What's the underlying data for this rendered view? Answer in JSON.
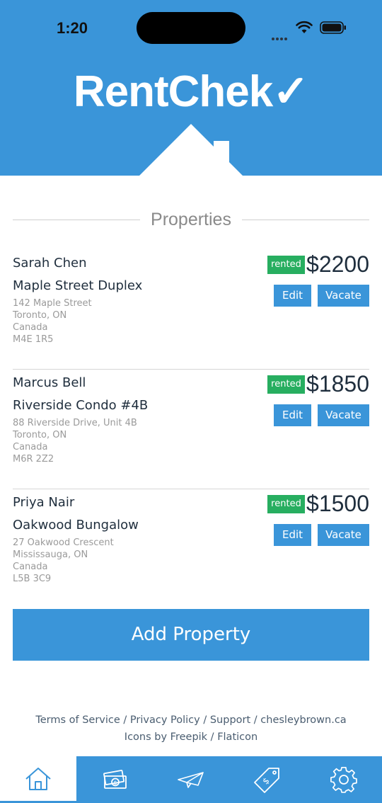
{
  "status_bar": {
    "time": "1:20"
  },
  "app": {
    "logo": "RentChek✓"
  },
  "section": {
    "title": "Properties"
  },
  "properties": [
    {
      "tenant": "Sarah Chen",
      "name": "Maple Street Duplex",
      "address": [
        "142 Maple Street",
        "Toronto, ON",
        "Canada",
        "M4E 1R5"
      ],
      "status": "rented",
      "rent": "$2200",
      "edit_label": "Edit",
      "vacate_label": "Vacate"
    },
    {
      "tenant": "Marcus Bell",
      "name": "Riverside Condo #4B",
      "address": [
        "88 Riverside Drive, Unit 4B",
        "Toronto, ON",
        "Canada",
        "M6R 2Z2"
      ],
      "status": "rented",
      "rent": "$1850",
      "edit_label": "Edit",
      "vacate_label": "Vacate"
    },
    {
      "tenant": "Priya Nair",
      "name": "Oakwood Bungalow",
      "address": [
        "27 Oakwood Crescent",
        "Mississauga, ON",
        "Canada",
        "L5B 3C9"
      ],
      "status": "rented",
      "rent": "$1500",
      "edit_label": "Edit",
      "vacate_label": "Vacate"
    }
  ],
  "add_button": {
    "label": "Add Property"
  },
  "footer": {
    "terms": "Terms of Service",
    "privacy": "Privacy Policy",
    "support": "Support",
    "site": "chesleybrown.ca",
    "sep": " / ",
    "credits_prefix": "Icons by ",
    "freepik": "Freepik",
    "flaticon": "Flaticon"
  },
  "tabbar": {
    "tabs": [
      {
        "icon": "home-icon",
        "active": true
      },
      {
        "icon": "money-icon",
        "active": false
      },
      {
        "icon": "paper-plane-icon",
        "active": false
      },
      {
        "icon": "price-tag-icon",
        "active": false
      },
      {
        "icon": "gear-icon",
        "active": false
      }
    ]
  },
  "colors": {
    "brand": "#3a95d9",
    "rented": "#27ae60",
    "tab_icon": "#ffffff",
    "active_tab_icon": "#3a95d9"
  }
}
